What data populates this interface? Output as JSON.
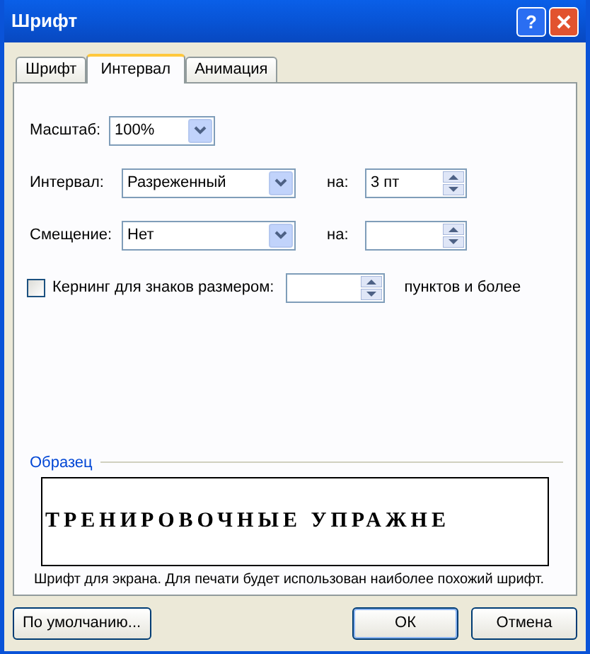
{
  "window": {
    "title": "Шрифт",
    "help_button": "?"
  },
  "tabs": [
    {
      "label": "Шрифт",
      "selected": false
    },
    {
      "label": "Интервал",
      "selected": true
    },
    {
      "label": "Анимация",
      "selected": false
    }
  ],
  "scale": {
    "label": "Масштаб:",
    "value": "100%"
  },
  "spacing": {
    "label": "Интервал:",
    "value": "Разреженный",
    "by_label": "на:",
    "by_value": "3 пт"
  },
  "position": {
    "label": "Смещение:",
    "value": "Нет",
    "by_label": "на:"
  },
  "kerning": {
    "label": "Кернинг для знаков размером:",
    "checked": false,
    "suffix": "пунктов и более"
  },
  "preview": {
    "title": "Образец",
    "sample": "ТРЕНИРОВОЧНЫЕ УПРАЖНЕ",
    "note": "Шрифт для экрана. Для печати будет использован наиболее похожий шрифт."
  },
  "buttons": [
    {
      "label": "По умолчанию...",
      "kind": "secondary"
    },
    {
      "label": "ОК",
      "kind": "default"
    },
    {
      "label": "Отмена",
      "kind": "secondary"
    }
  ]
}
